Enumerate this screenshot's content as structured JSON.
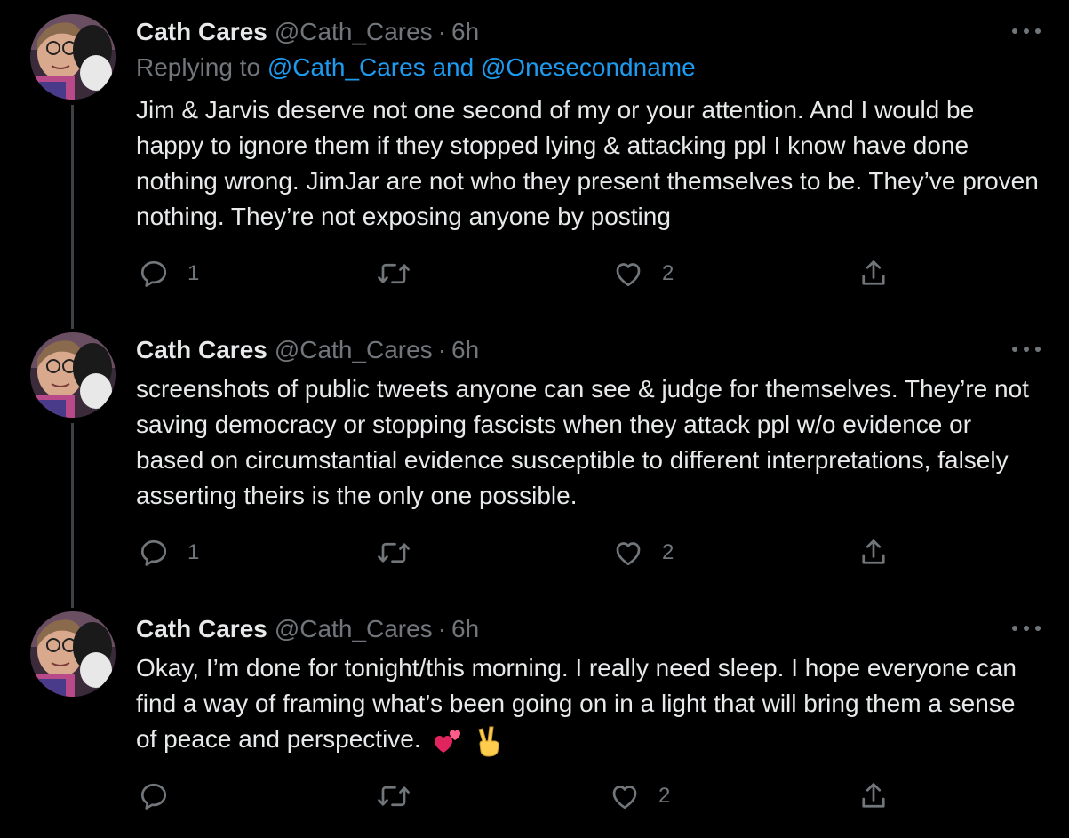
{
  "tweets": [
    {
      "name": "Cath Cares",
      "handle": "@Cath_Cares",
      "separator": "·",
      "time": "6h",
      "replying_prefix": "Replying to",
      "replying_users": "@Cath_Cares and @Onesecondname",
      "text": "Jim & Jarvis deserve not one second of my or your attention. And I would be happy to ignore them if they stopped lying & attacking ppl I know have done nothing wrong. JimJar are not who they present themselves to be. They’ve proven nothing. They’re not exposing anyone by posting",
      "reply_count": "1",
      "retweet_count": "",
      "like_count": "2"
    },
    {
      "name": "Cath Cares",
      "handle": "@Cath_Cares",
      "separator": "·",
      "time": "6h",
      "text": "screenshots of public tweets anyone can see & judge for themselves. They’re not saving democracy or stopping fascists when they attack ppl w/o evidence or based on circumstantial evidence susceptible to different interpretations, falsely asserting theirs is the only one possible.",
      "reply_count": "1",
      "retweet_count": "",
      "like_count": "2"
    },
    {
      "name": "Cath Cares",
      "handle": "@Cath_Cares",
      "separator": "·",
      "time": "6h",
      "text": "Okay, I’m done for tonight/this morning. I really need sleep. I hope everyone can find a way of framing what’s been going on in a light that will bring them a sense of peace and perspective.",
      "emojis": [
        "two-hearts-emoji",
        "victory-hand-emoji"
      ],
      "reply_count": "",
      "retweet_count": "",
      "like_count": "2"
    }
  ],
  "colors": {
    "background": "#000000",
    "text": "#e7e9ea",
    "muted": "#71767b",
    "link": "#1d9bf0",
    "thread_line": "#3e4144"
  },
  "icons": [
    "more-icon",
    "reply-icon",
    "retweet-icon",
    "like-icon",
    "share-icon"
  ]
}
